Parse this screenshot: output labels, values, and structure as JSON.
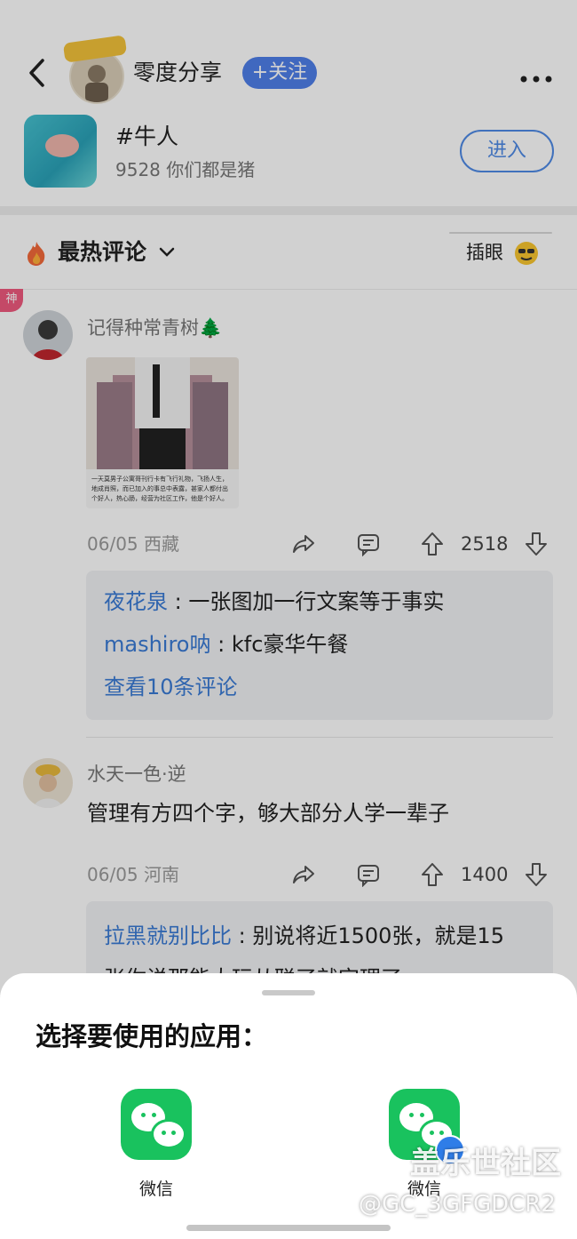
{
  "header": {
    "back_icon": "chevron-left-icon",
    "avatar_badge": "yu-zhu-le",
    "username": "零度分享",
    "follow_label": "+关注",
    "more_icon": "more-dots-icon"
  },
  "topic": {
    "title": "#牛人",
    "subtitle": "9528 你们都是猪",
    "enter_label": "进入"
  },
  "comments_header": {
    "title": "最热评论",
    "sort_icon": "chevron-down-icon",
    "fire_icon": "fire-icon",
    "chip_label": "插眼",
    "chip_icon": "smiley-sunglasses-icon"
  },
  "comments": [
    {
      "badge": "神",
      "user": "记得种常青树🌲",
      "image_caption": "一天莫男子公寓哥刊行卡有飞行礼物，飞扬人生，地成肖照，而已加入的事总中表露，甚家人都付出个好人，热心肠，经营为社区工作，他是个好人。",
      "meta": "06/05 西藏",
      "likes": "2518",
      "replies": [
        {
          "name": "夜花泉",
          "text": "一张图加一行文案等于事实"
        },
        {
          "name": "mashiro呐",
          "text": "kfc豪华午餐"
        }
      ],
      "view_more": "查看10条评论"
    },
    {
      "user": "水天一色·逆",
      "text": "管理有方四个字，够大部分人学一辈子",
      "meta": "06/05 河南",
      "likes": "1400",
      "replies": [
        {
          "name": "拉黑就别比比",
          "text": "别说将近1500张，就是15"
        }
      ],
      "cutoff_line": "张你说那能大玩从联了就完理了"
    }
  ],
  "sheet": {
    "title": "选择要使用的应用：",
    "apps": [
      {
        "label": "微信",
        "icon": "wechat-icon"
      },
      {
        "label": "微信",
        "icon": "wechat-icon"
      }
    ]
  },
  "watermark": {
    "line1": "盖乐世社区",
    "line2": "@GC_3GFGDCR2"
  },
  "colors": {
    "accent": "#4f7fe9",
    "link": "#3a7bd5",
    "wechat": "#19c25e"
  }
}
